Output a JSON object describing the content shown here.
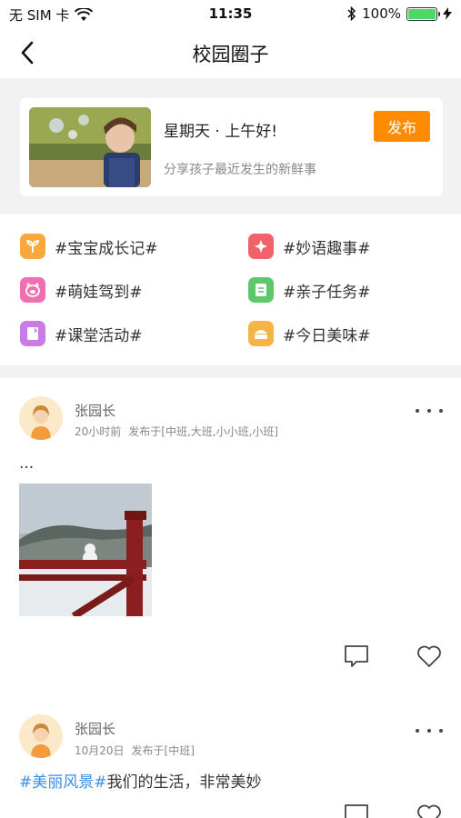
{
  "status_bar": {
    "carrier": "无 SIM 卡",
    "time": "11:35",
    "battery": "100%",
    "battery_level": 1.0
  },
  "nav": {
    "title": "校园圈子",
    "back_icon": "chevron-left-icon"
  },
  "compose": {
    "greeting": "星期天 · 上午好!",
    "subtitle": "分享孩子最近发生的新鲜事",
    "publish_label": "发布"
  },
  "topics": [
    {
      "label": "#宝宝成长记#",
      "icon": "sprout-icon",
      "color": "#f7a93b"
    },
    {
      "label": "#妙语趣事#",
      "icon": "sparkle-icon",
      "color": "#f2626b"
    },
    {
      "label": "#萌娃驾到#",
      "icon": "pig-icon",
      "color": "#f06fb0"
    },
    {
      "label": "#亲子任务#",
      "icon": "notes-icon",
      "color": "#5cc86a"
    },
    {
      "label": "#课堂活动#",
      "icon": "book-icon",
      "color": "#c97be6"
    },
    {
      "label": "#今日美味#",
      "icon": "food-icon",
      "color": "#f6b444"
    }
  ],
  "posts": [
    {
      "author": "张园长",
      "time": "20小时前",
      "published_to": "发布于[中班,大班,小小班,小班]",
      "text": "...",
      "hashtag": "",
      "has_image": true
    },
    {
      "author": "张园长",
      "time": "10月20日",
      "published_to": "发布于[中班]",
      "hashtag": "#美丽风景#",
      "text": "我们的生活，非常美妙",
      "has_image": false
    }
  ],
  "colors": {
    "accent": "#ff8c00",
    "hashtag": "#3a8ee6"
  }
}
